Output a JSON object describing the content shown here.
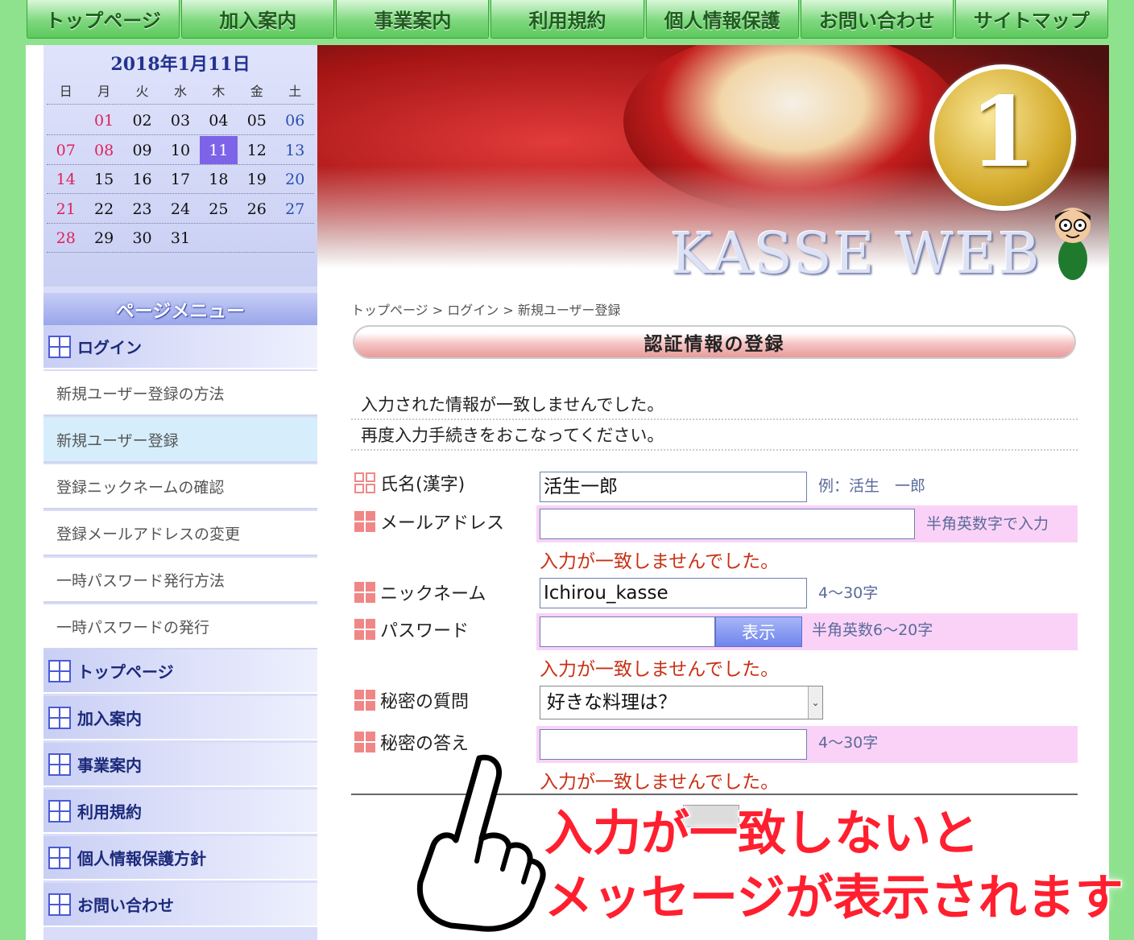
{
  "nav": [
    "トップページ",
    "加入案内",
    "事業案内",
    "利用規約",
    "個人情報保護",
    "お問い合わせ",
    "サイトマップ"
  ],
  "calendar": {
    "title": "2018年1月11日",
    "weekdays": [
      "日",
      "月",
      "火",
      "水",
      "木",
      "金",
      "土"
    ],
    "weeks": [
      [
        "",
        "01",
        "02",
        "03",
        "04",
        "05",
        "06"
      ],
      [
        "07",
        "08",
        "09",
        "10",
        "11",
        "12",
        "13"
      ],
      [
        "14",
        "15",
        "16",
        "17",
        "18",
        "19",
        "20"
      ],
      [
        "21",
        "22",
        "23",
        "24",
        "25",
        "26",
        "27"
      ],
      [
        "28",
        "29",
        "30",
        "31",
        "",
        "",
        ""
      ]
    ],
    "red_days": [
      "01",
      "07",
      "08",
      "14",
      "21",
      "28"
    ],
    "today": "11"
  },
  "sidebar": {
    "menu_title": "ページメニュー",
    "login": "ログイン",
    "sub_items": [
      "新規ユーザー登録の方法",
      "新規ユーザー登録",
      "登録ニックネームの確認",
      "登録メールアドレスの変更",
      "一時パスワード発行方法",
      "一時パスワードの発行"
    ],
    "main_items": [
      "トップページ",
      "加入案内",
      "事業案内",
      "利用規約",
      "個人情報保護方針",
      "お問い合わせ"
    ]
  },
  "banner": {
    "badge_number": "1",
    "logo": "KASSE WEB"
  },
  "breadcrumb": {
    "home": "トップページ",
    "sep": " > ",
    "login": "ログイン",
    "current": "新規ユーザー登録"
  },
  "heading": "認証情報の登録",
  "messages": [
    "入力された情報が一致しませんでした。",
    "再度入力手続きをおこなってください。"
  ],
  "form": {
    "name_label": "氏名(漢字)",
    "name_value": "活生一郎",
    "name_hint": "例：活生　一郎",
    "email_label": "メールアドレス",
    "email_value": "",
    "email_hint": "半角英数字で入力",
    "email_error": "入力が一致しませんでした。",
    "nick_label": "ニックネーム",
    "nick_value": "Ichirou_kasse",
    "nick_hint": "4〜30字",
    "pass_label": "パスワード",
    "pass_value": "",
    "show_button": "表示",
    "pass_hint": "半角英数6〜20字",
    "pass_error": "入力が一致しませんでした。",
    "question_label": "秘密の質問",
    "question_value": "好きな料理は？",
    "answer_label": "秘密の答え",
    "answer_value": "",
    "answer_hint": "4〜30字",
    "answer_error": "入力が一致しませんでした。"
  },
  "annotation": [
    "入力が一致しないと",
    "メッセージが表示されます"
  ],
  "colors": {
    "nav_green": "#7ed87e",
    "error": "#c93014",
    "pink_highlight": "#fbd2f7",
    "annotation_red": "#ff1f2f"
  }
}
